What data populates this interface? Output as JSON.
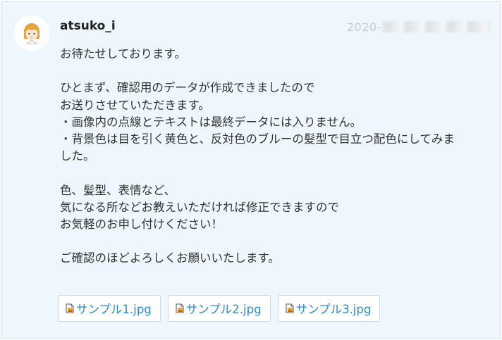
{
  "message": {
    "username": "atsuko_i",
    "timestamp_visible": "2020-",
    "body_lines": [
      "お待たせしております。",
      "",
      "ひとまず、確認用のデータが作成できましたので",
      "お送りさせていただきます。",
      "・画像内の点線とテキストは最終データには入りません。",
      "・背景色は目を引く黄色と、反対色のブルーの髪型で目立つ配色にしてみま",
      "した。",
      "",
      "色、髪型、表情など、",
      "気になる所などお教えいただければ修正できますので",
      "お気軽のお申し付けください！",
      "",
      "ご確認のほどよろしくお願いいたします。"
    ],
    "attachments": [
      {
        "label": "サンプル1.jpg",
        "icon": "image-file-icon"
      },
      {
        "label": "サンプル2.jpg",
        "icon": "image-file-icon"
      },
      {
        "label": "サンプル3.jpg",
        "icon": "image-file-icon"
      }
    ]
  },
  "colors": {
    "card_background": "#eef7fd",
    "card_border": "#cfe3f0",
    "link": "#2a8cc8",
    "timestamp": "#c4cbd1"
  }
}
